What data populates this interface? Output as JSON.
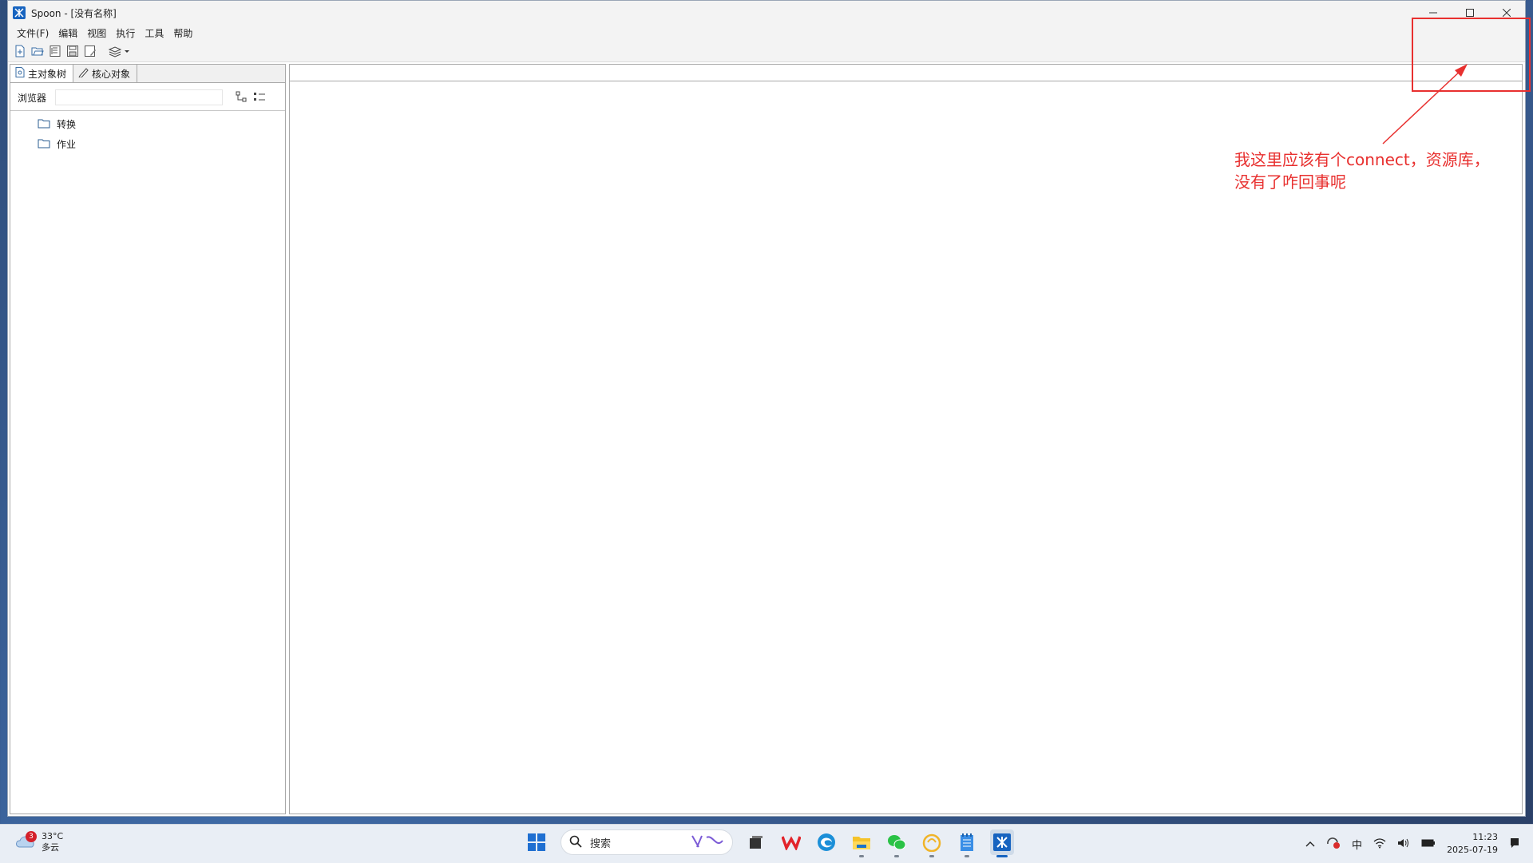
{
  "window": {
    "title": "Spoon - [没有名称]",
    "controls": [
      "minimize-icon",
      "maximize-icon",
      "close-icon"
    ]
  },
  "menu": [
    "文件(F)",
    "编辑",
    "视图",
    "执行",
    "工具",
    "帮助"
  ],
  "toolbar": {
    "icons": [
      "new-file-icon",
      "open-folder-icon",
      "explore-repository-icon",
      "save-icon",
      "save-as-icon",
      "perspective-layers-icon"
    ]
  },
  "left_panel": {
    "tabs": [
      {
        "label": "主对象树",
        "icon": "document-icon",
        "active": true
      },
      {
        "label": "核心对象",
        "icon": "pencil-icon",
        "active": false
      }
    ],
    "search": {
      "label": "浏览器",
      "value": "",
      "placeholder": ""
    },
    "tree": [
      {
        "label": "转换",
        "icon": "folder-icon"
      },
      {
        "label": "作业",
        "icon": "folder-icon"
      }
    ]
  },
  "annotation": {
    "text_line1": "我这里应该有个connect，资源库，",
    "text_line2": "没有了咋回事呢",
    "color": "#e8302f"
  },
  "taskbar": {
    "weather": {
      "badge": "3",
      "temp": "33°C",
      "desc": "多云"
    },
    "search_placeholder": "搜索",
    "apps": [
      "start-icon",
      "task-view-icon",
      "wps-icon",
      "edge-icon",
      "file-explorer-icon",
      "wechat-icon",
      "orange-app-icon",
      "notepad-icon",
      "spoon-icon"
    ],
    "tray": {
      "ime": "中",
      "time": "11:23",
      "date": "2025-07-19"
    }
  }
}
